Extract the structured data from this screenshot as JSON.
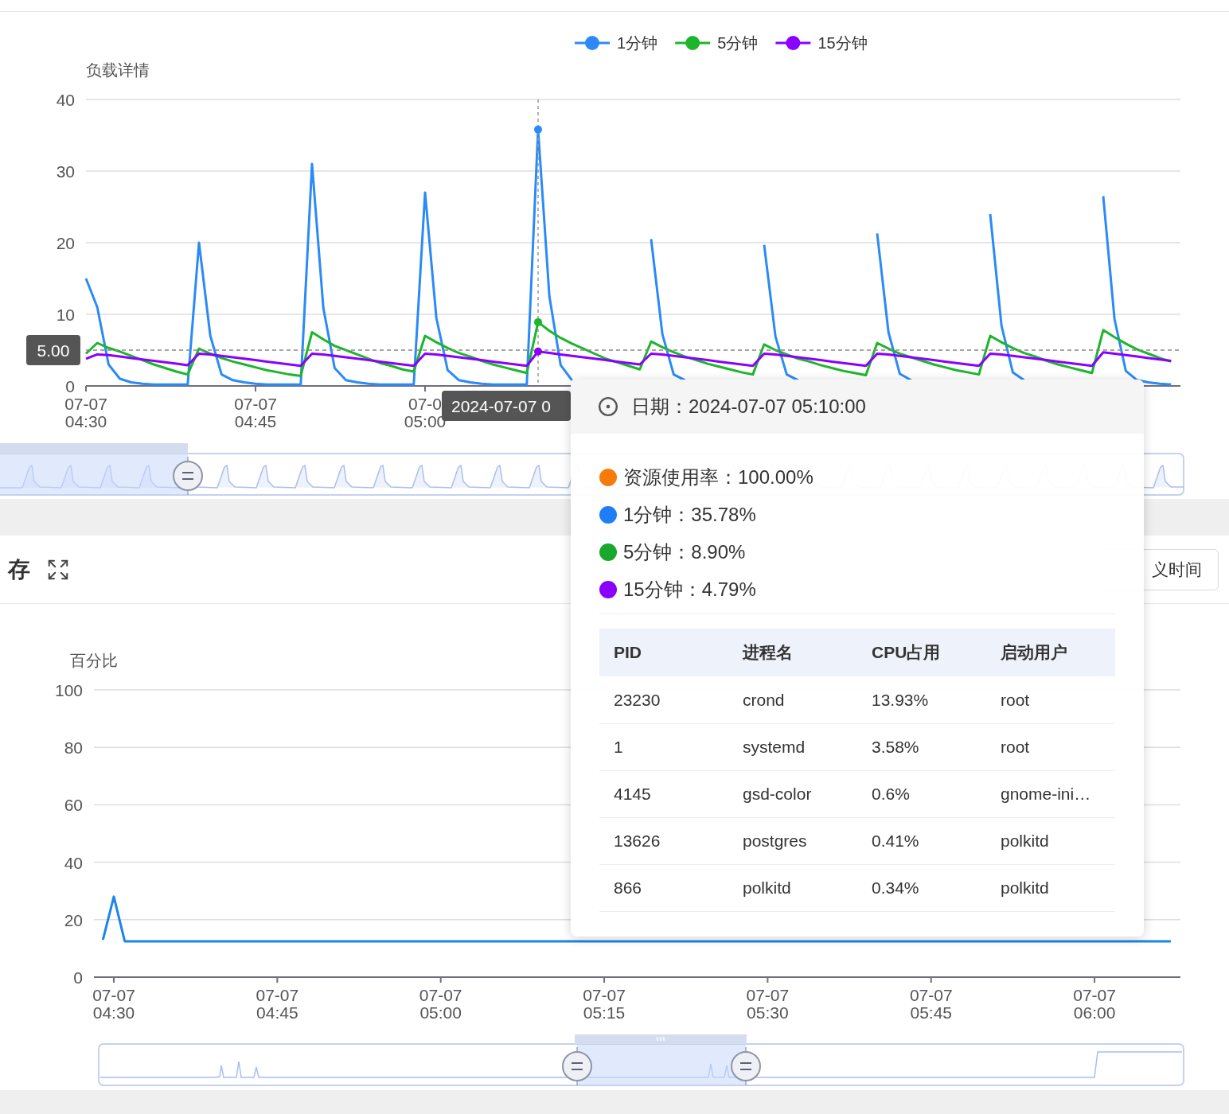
{
  "load_panel": {
    "chart_data": {
      "type": "line",
      "ylabel": "负载详情",
      "categories": [
        "07-07\n04:30",
        null,
        null,
        null,
        null,
        null,
        null,
        null,
        null,
        null,
        null,
        null,
        null,
        null,
        null,
        "07-07\n04:45",
        null,
        null,
        null,
        null,
        null,
        null,
        null,
        null,
        null,
        null,
        null,
        null,
        null,
        null,
        "07-0\n05:00",
        null,
        null,
        null,
        null,
        null,
        null,
        null,
        null,
        null,
        null,
        null,
        null,
        null,
        null,
        null,
        null,
        null,
        null,
        null,
        null,
        null,
        null,
        null,
        null,
        null,
        null,
        null,
        null,
        null,
        null,
        null,
        null,
        null,
        null,
        null,
        null,
        null,
        null,
        null,
        null,
        null,
        null,
        null,
        null,
        null,
        null,
        null,
        null,
        null,
        null,
        null,
        null,
        null,
        null,
        null,
        null,
        null,
        null,
        null,
        null,
        null,
        null,
        null,
        null,
        null,
        null
      ],
      "series": [
        {
          "name": "1分钟",
          "color": "#2b8af7",
          "values": [
            15,
            11,
            3,
            1,
            0.5,
            0.3,
            0.2,
            0.2,
            0.2,
            0.2,
            20,
            7,
            1.6,
            0.8,
            0.5,
            0.3,
            0.2,
            0.2,
            0.2,
            0.2,
            31,
            10.9,
            2.5,
            0.8,
            0.5,
            0.3,
            0.2,
            0.2,
            0.2,
            0.2,
            27,
            9.5,
            2.2,
            0.8,
            0.5,
            0.3,
            0.2,
            0.2,
            0.2,
            0.2,
            35.8,
            12.5,
            2.9,
            0.8,
            null,
            null,
            null,
            null,
            null,
            null,
            20.5,
            7.2,
            1.6,
            0.8,
            null,
            null,
            null,
            null,
            null,
            null,
            19.7,
            6.9,
            1.6,
            0.8,
            null,
            null,
            null,
            null,
            null,
            null,
            21.3,
            7.5,
            1.7,
            0.8,
            null,
            null,
            null,
            null,
            null,
            null,
            24,
            8.4,
            1.9,
            0.8,
            null,
            null,
            null,
            null,
            null,
            null,
            26.5,
            9.3,
            2.1,
            0.8,
            0.5,
            0.3,
            0.2
          ]
        },
        {
          "name": "5分钟",
          "color": "#1db52c",
          "values": [
            4.5,
            6,
            5.3,
            4.8,
            4.2,
            3.6,
            3,
            2.5,
            2,
            1.6,
            5.2,
            4.5,
            3.9,
            3.4,
            3,
            2.6,
            2.2,
            1.9,
            1.6,
            1.4,
            7.5,
            6.5,
            5.6,
            5,
            4.4,
            3.8,
            3.2,
            2.8,
            2.3,
            2,
            7,
            6.1,
            5.3,
            4.6,
            4.1,
            3.5,
            3,
            2.6,
            2.2,
            1.8,
            8.9,
            7.7,
            6.7,
            5.9,
            5.2,
            4.5,
            3.8,
            3.3,
            2.8,
            2.3,
            6.2,
            5.4,
            4.7,
            4.1,
            3.6,
            3.1,
            2.7,
            2.3,
            1.9,
            1.6,
            5.8,
            5,
            4.4,
            3.8,
            3.4,
            2.9,
            2.5,
            2.1,
            1.8,
            1.5,
            6,
            5.2,
            4.5,
            4,
            3.5,
            3,
            2.6,
            2.2,
            1.9,
            1.6,
            7,
            6.1,
            5.3,
            4.6,
            4.1,
            3.5,
            3,
            2.6,
            2.2,
            1.8,
            7.8,
            6.8,
            5.9,
            5.1,
            4.5,
            3.9,
            3.4
          ]
        },
        {
          "name": "15分钟",
          "color": "#8a00ff",
          "values": [
            3.8,
            4.4,
            4.3,
            4.1,
            3.9,
            3.7,
            3.5,
            3.3,
            3.1,
            2.9,
            4.5,
            4.4,
            4.2,
            4,
            3.8,
            3.6,
            3.4,
            3.2,
            3,
            2.8,
            4.5,
            4.4,
            4.2,
            4,
            3.8,
            3.6,
            3.4,
            3.2,
            3,
            2.8,
            4.5,
            4.4,
            4.2,
            4,
            3.8,
            3.6,
            3.4,
            3.2,
            3,
            2.8,
            4.8,
            4.6,
            4.4,
            4.2,
            4,
            3.8,
            3.6,
            3.4,
            3.2,
            3,
            4.5,
            4.4,
            4.2,
            4,
            3.8,
            3.6,
            3.4,
            3.2,
            3,
            2.8,
            4.5,
            4.4,
            4.2,
            4,
            3.8,
            3.6,
            3.4,
            3.2,
            3,
            2.8,
            4.5,
            4.4,
            4.2,
            4,
            3.8,
            3.6,
            3.4,
            3.2,
            3,
            2.8,
            4.5,
            4.4,
            4.2,
            4,
            3.8,
            3.6,
            3.4,
            3.2,
            3,
            2.8,
            4.7,
            4.5,
            4.3,
            4.1,
            3.9,
            3.7,
            3.5
          ]
        }
      ],
      "ylim": [
        0,
        40
      ],
      "yticks": [
        0,
        10,
        20,
        30,
        40
      ],
      "grid": true,
      "legend": "top",
      "ref_lines": [
        {
          "axis": "y",
          "value": 5
        }
      ]
    },
    "axis_pointer": {
      "y_label": "5.00",
      "x_label": "2024-07-07 0"
    }
  },
  "memory_panel": {
    "title": "存",
    "custom_range_button": {
      "label": "义时间"
    },
    "chart_data": {
      "type": "line",
      "ylabel": "百分比",
      "categories": [
        null,
        "07-07\n04:30",
        null,
        null,
        null,
        null,
        null,
        null,
        null,
        null,
        null,
        null,
        null,
        null,
        null,
        null,
        "07-07\n04:45",
        null,
        null,
        null,
        null,
        null,
        null,
        null,
        null,
        null,
        null,
        null,
        null,
        null,
        null,
        "07-07\n05:00",
        null,
        null,
        null,
        null,
        null,
        null,
        null,
        null,
        null,
        null,
        null,
        null,
        null,
        null,
        "07-07\n05:15",
        null,
        null,
        null,
        null,
        null,
        null,
        null,
        null,
        null,
        null,
        null,
        null,
        null,
        null,
        "07-07\n05:30",
        null,
        null,
        null,
        null,
        null,
        null,
        null,
        null,
        null,
        null,
        null,
        null,
        null,
        null,
        "07-07\n05:45",
        null,
        null,
        null,
        null,
        null,
        null,
        null,
        null,
        null,
        null,
        null,
        null,
        null,
        null,
        "07-07\n06:00",
        null,
        null,
        null,
        null,
        null,
        null,
        null
      ],
      "series": [
        {
          "color": "#1a86e8",
          "values": [
            13,
            28,
            12.5,
            12.5,
            12.5,
            12.5,
            12.5,
            12.5,
            12.5,
            12.5,
            12.5,
            12.5,
            12.5,
            12.5,
            12.5,
            12.5,
            12.5,
            12.5,
            12.5,
            12.5,
            12.5,
            12.5,
            12.5,
            12.5,
            12.5,
            12.5,
            12.5,
            12.5,
            12.5,
            12.5,
            12.5,
            12.5,
            12.5,
            12.5,
            12.5,
            12.5,
            12.5,
            12.5,
            12.5,
            12.5,
            12.5,
            12.5,
            12.5,
            12.5,
            12.5,
            12.5,
            12.5,
            12.5,
            12.5,
            12.5,
            12.5,
            12.5,
            12.5,
            12.5,
            12.5,
            12.5,
            12.5,
            12.5,
            12.5,
            12.5,
            12.5,
            12.5,
            12.5,
            12.5,
            12.5,
            12.5,
            12.5,
            12.5,
            12.5,
            12.5,
            12.5,
            12.5,
            12.5,
            12.5,
            12.5,
            12.5,
            12.5,
            12.5,
            12.5,
            12.5,
            12.5,
            12.5,
            12.5,
            12.5,
            12.5,
            12.5,
            12.5,
            12.5,
            12.5,
            12.5,
            12.5,
            12.5,
            12.5,
            12.5,
            12.5,
            12.5,
            12.5,
            12.5,
            12.5
          ]
        }
      ],
      "ylim": [
        0,
        100
      ],
      "yticks": [
        0,
        20,
        40,
        60,
        80,
        100
      ],
      "grid": true
    }
  },
  "tooltip": {
    "date": "日期：2024-07-07 05:10:00",
    "items": [
      {
        "text": "资源使用率：100.00%",
        "color": "#f77b0c"
      },
      {
        "text": "1分钟：35.78%",
        "color": "#1e7ef7"
      },
      {
        "text": "5分钟：8.90%",
        "color": "#18a82b"
      },
      {
        "text": "15分钟：4.79%",
        "color": "#8a00ff"
      }
    ],
    "table": {
      "columns": [
        "PID",
        "进程名",
        "CPU占用",
        "启动用户"
      ],
      "rows": [
        [
          "23230",
          "crond",
          "13.93%",
          "root"
        ],
        [
          "1",
          "systemd",
          "3.58%",
          "root"
        ],
        [
          "4145",
          "gsd-color",
          "0.6%",
          "gnome-ini…"
        ],
        [
          "13626",
          "postgres",
          "0.41%",
          "polkitd"
        ],
        [
          "866",
          "polkitd",
          "0.34%",
          "polkitd"
        ]
      ]
    }
  }
}
